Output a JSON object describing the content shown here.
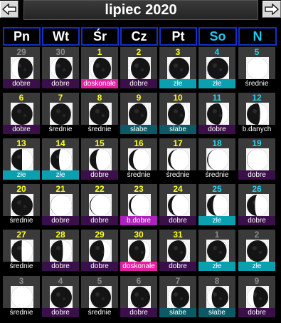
{
  "header": {
    "title": "lipiec 2020",
    "prev_icon": "left-arrow-icon",
    "next_icon": "right-arrow-icon"
  },
  "weekdays": [
    {
      "label": "Pn",
      "weekend": false
    },
    {
      "label": "Wt",
      "weekend": false
    },
    {
      "label": "Śr",
      "weekend": false
    },
    {
      "label": "Cz",
      "weekend": false
    },
    {
      "label": "Pt",
      "weekend": false
    },
    {
      "label": "So",
      "weekend": true
    },
    {
      "label": "N",
      "weekend": true
    }
  ],
  "rating_colors": {
    "dobre": "#3a0f4a",
    "doskonałe": "#e020a0",
    "złe": "#0aa0b0",
    "średnie": "#000000",
    "słabe": "#0c5a66",
    "b.danych": "#000000",
    "b.dobre": "#b020c0"
  },
  "weeks": [
    [
      {
        "day": "29",
        "other": true,
        "rating": "dobre",
        "moon": {
          "illum": 0.7,
          "waxing": false
        }
      },
      {
        "day": "30",
        "other": true,
        "rating": "dobre",
        "moon": {
          "illum": 0.78,
          "waxing": false
        }
      },
      {
        "day": "1",
        "rating": "doskonałe",
        "moon": {
          "illum": 0.84,
          "waxing": false
        }
      },
      {
        "day": "2",
        "rating": "dobre",
        "moon": {
          "illum": 0.9,
          "waxing": false
        }
      },
      {
        "day": "3",
        "rating": "złe",
        "moon": {
          "illum": 0.95,
          "waxing": false
        }
      },
      {
        "day": "4",
        "weekend": true,
        "rating": "złe",
        "moon": {
          "illum": 0.99,
          "waxing": false
        }
      },
      {
        "day": "5",
        "weekend": true,
        "rating": "średnie",
        "moon": {
          "illum": 1.0,
          "waxing": false
        }
      }
    ],
    [
      {
        "day": "6",
        "rating": "dobre",
        "moon": {
          "illum": 0.99,
          "waxing": true
        }
      },
      {
        "day": "7",
        "rating": "średnie",
        "moon": {
          "illum": 0.96,
          "waxing": true
        }
      },
      {
        "day": "8",
        "rating": "średnie",
        "moon": {
          "illum": 0.92,
          "waxing": true
        }
      },
      {
        "day": "9",
        "rating": "słabe",
        "moon": {
          "illum": 0.87,
          "waxing": true
        }
      },
      {
        "day": "10",
        "rating": "słabe",
        "moon": {
          "illum": 0.8,
          "waxing": true
        }
      },
      {
        "day": "11",
        "weekend": true,
        "rating": "dobre",
        "moon": {
          "illum": 0.72,
          "waxing": true
        }
      },
      {
        "day": "12",
        "weekend": true,
        "rating": "b.danych",
        "moon": {
          "illum": 0.62,
          "waxing": true
        }
      }
    ],
    [
      {
        "day": "13",
        "rating": "złe",
        "moon": {
          "illum": 0.5,
          "waxing": true
        }
      },
      {
        "day": "14",
        "rating": "złe",
        "moon": {
          "illum": 0.4,
          "waxing": true
        }
      },
      {
        "day": "15",
        "rating": "dobre",
        "moon": {
          "illum": 0.3,
          "waxing": true
        }
      },
      {
        "day": "16",
        "rating": "średnie",
        "moon": {
          "illum": 0.2,
          "waxing": true
        }
      },
      {
        "day": "17",
        "rating": "średnie",
        "moon": {
          "illum": 0.12,
          "waxing": true
        }
      },
      {
        "day": "18",
        "weekend": true,
        "rating": "średnie",
        "moon": {
          "illum": 0.05,
          "waxing": true
        }
      },
      {
        "day": "19",
        "weekend": true,
        "rating": "dobre",
        "moon": {
          "illum": 0.01,
          "waxing": true
        }
      }
    ],
    [
      {
        "day": "20",
        "rating": "średnie",
        "moon": {
          "illum": 0.0,
          "waxing": true
        }
      },
      {
        "day": "21",
        "rating": "dobre",
        "moon": {
          "illum": 0.01,
          "waxing": true
        }
      },
      {
        "day": "22",
        "rating": "dobre",
        "moon": {
          "illum": 0.04,
          "waxing": true
        }
      },
      {
        "day": "23",
        "rating": "b.dobre",
        "moon": {
          "illum": 0.1,
          "waxing": true
        }
      },
      {
        "day": "24",
        "rating": "dobre",
        "moon": {
          "illum": 0.18,
          "waxing": true
        }
      },
      {
        "day": "25",
        "weekend": true,
        "rating": "złe",
        "moon": {
          "illum": 0.28,
          "waxing": true
        }
      },
      {
        "day": "26",
        "weekend": true,
        "rating": "dobre",
        "moon": {
          "illum": 0.38,
          "waxing": true
        }
      }
    ],
    [
      {
        "day": "27",
        "rating": "średnie",
        "moon": {
          "illum": 0.48,
          "waxing": true
        }
      },
      {
        "day": "28",
        "rating": "dobre",
        "moon": {
          "illum": 0.58,
          "waxing": true
        }
      },
      {
        "day": "29",
        "rating": "dobre",
        "moon": {
          "illum": 0.68,
          "waxing": true
        }
      },
      {
        "day": "30",
        "rating": "doskonałe",
        "moon": {
          "illum": 0.78,
          "waxing": true
        }
      },
      {
        "day": "31",
        "rating": "dobre",
        "moon": {
          "illum": 0.86,
          "waxing": true
        }
      },
      {
        "day": "1",
        "other": true,
        "rating": "złe",
        "moon": {
          "illum": 0.92,
          "waxing": true
        }
      },
      {
        "day": "2",
        "other": true,
        "rating": "złe",
        "moon": {
          "illum": 0.97,
          "waxing": true
        }
      }
    ],
    [
      {
        "day": "3",
        "other": true,
        "rating": "średnie",
        "moon": {
          "illum": 1.0,
          "waxing": true
        }
      },
      {
        "day": "4",
        "other": true,
        "rating": "dobre",
        "moon": {
          "illum": 0.99,
          "waxing": false
        }
      },
      {
        "day": "5",
        "other": true,
        "rating": "średnie",
        "moon": {
          "illum": 0.96,
          "waxing": false
        }
      },
      {
        "day": "6",
        "other": true,
        "rating": "dobre",
        "moon": {
          "illum": 0.91,
          "waxing": false
        }
      },
      {
        "day": "7",
        "other": true,
        "rating": "słabe",
        "moon": {
          "illum": 0.85,
          "waxing": false
        }
      },
      {
        "day": "8",
        "other": true,
        "rating": "słabe",
        "moon": {
          "illum": 0.78,
          "waxing": false
        }
      },
      {
        "day": "9",
        "other": true,
        "rating": "dobre",
        "moon": {
          "illum": 0.7,
          "waxing": false
        }
      }
    ]
  ]
}
